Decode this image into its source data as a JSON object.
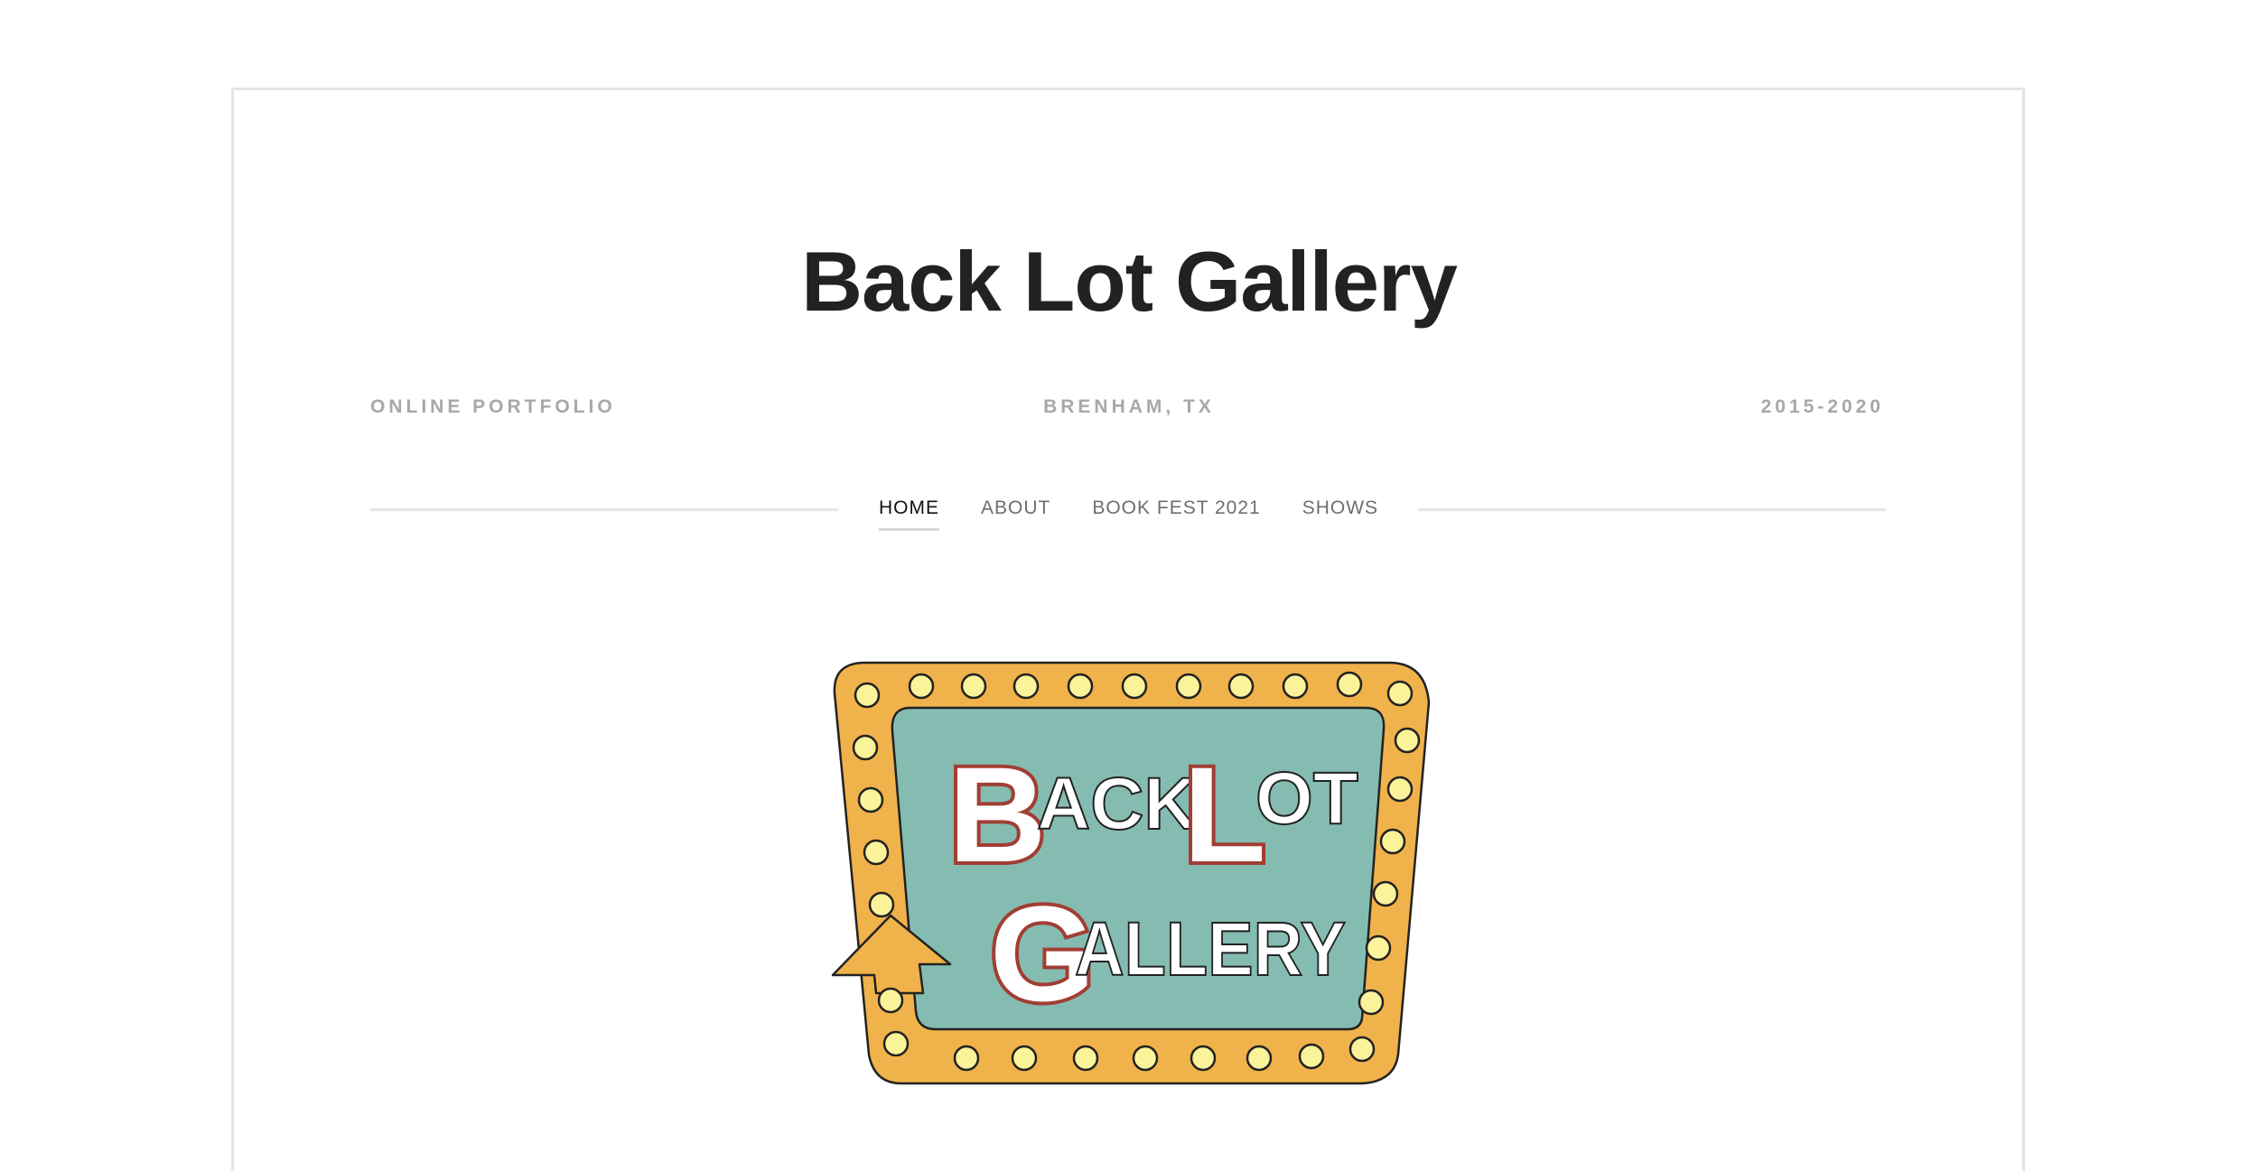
{
  "site": {
    "title": "Back Lot Gallery",
    "taglines": {
      "left": "ONLINE PORTFOLIO",
      "center": "BRENHAM, TX",
      "right": "2015-2020"
    }
  },
  "nav": {
    "items": [
      {
        "label": "HOME",
        "active": true
      },
      {
        "label": "ABOUT",
        "active": false
      },
      {
        "label": "BOOK FEST 2021",
        "active": false
      },
      {
        "label": "SHOWS",
        "active": false
      }
    ]
  },
  "logo": {
    "line1_initial": "B",
    "line1_rest_a": "ACK",
    "line1_initial_b": "L",
    "line1_rest_b": "OT",
    "line2_initial": "G",
    "line2_rest": "ALLERY"
  },
  "colors": {
    "sign_orange": "#f0b24a",
    "sign_teal": "#85bcb2",
    "bulb_yellow": "#fbf39a",
    "letter_red": "#a23e34",
    "title_text": "#222222",
    "tagline_text": "#a8a8a8"
  }
}
